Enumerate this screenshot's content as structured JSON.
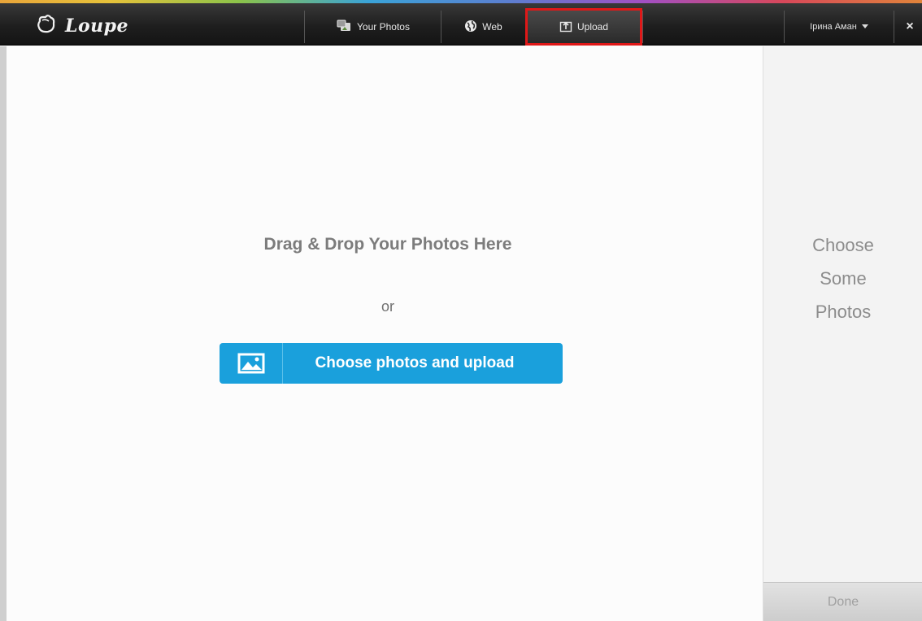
{
  "app": {
    "name": "Loupe"
  },
  "nav": {
    "tabs": [
      {
        "label": "Your Photos",
        "icon": "photos-icon"
      },
      {
        "label": "Web",
        "icon": "globe-icon"
      },
      {
        "label": "Upload",
        "icon": "upload-icon",
        "active": true
      }
    ],
    "user": {
      "name": "Ірина Аман",
      "icon": "caret-down-icon"
    },
    "close": {
      "label": "×",
      "icon": "close-icon"
    }
  },
  "main": {
    "drop_title": "Drag & Drop Your Photos Here",
    "or_text": "or",
    "upload_button": {
      "label": "Choose photos and upload",
      "icon": "image-icon"
    }
  },
  "sidebar": {
    "hint_lines": [
      "Choose",
      "Some",
      "Photos"
    ],
    "done_label": "Done"
  },
  "colors": {
    "accent": "#1aa0dc",
    "active_tab_border": "#e01818",
    "topbar": "#1e1e1e"
  }
}
